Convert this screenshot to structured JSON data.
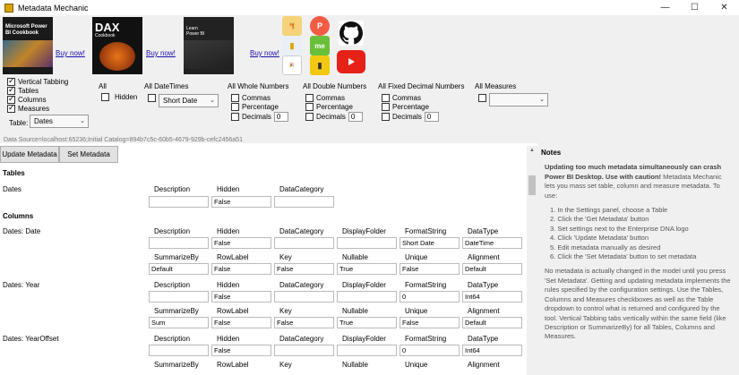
{
  "window": {
    "title": "Metadata Mechanic",
    "controls": [
      "—",
      "☐",
      "✕"
    ]
  },
  "books": [
    {
      "title_line1": "Microsoft Power",
      "title_line2": "BI Cookbook",
      "buy_label": "Buy now!",
      "color": "#1a1a1a"
    },
    {
      "title_line1": "DAX",
      "title_line2": "Cookbook",
      "buy_label": "Buy now!",
      "color": "#b83a0c"
    },
    {
      "title_line1": "Learn",
      "title_line2": "Power BI",
      "buy_label": "Buy now!",
      "color": "#222222"
    }
  ],
  "social_icons": [
    "pancake-icon",
    "patreon-icon",
    "pbi-icon",
    "me-icon",
    "celebrating-icon",
    "power-bi-icon",
    "github-icon",
    "youtube-icon"
  ],
  "settings": {
    "vertical_tabbing": "Vertical Tabbing",
    "tables": "Tables",
    "columns": "Columns",
    "measures": "Measures",
    "table_label": "Table:",
    "table_value": "Dates",
    "all_label": "All",
    "hidden_label": "Hidden",
    "all_datetimes": "All DateTimes",
    "datetime_format": "Short Date",
    "all_whole_numbers": "All Whole Numbers",
    "all_double_numbers": "All Double Numbers",
    "all_fixed_decimal": "All Fixed Decimal Numbers",
    "all_measures": "All Measures",
    "commas": "Commas",
    "percentage": "Percentage",
    "decimals": "Decimals",
    "decimals_value": "0",
    "data_source": "Data Source=localhost:65236;Initial Catalog=894b7c5c-60b5-4679-929b-cefc2456a51"
  },
  "buttons": {
    "update": "Update Metadata",
    "set": "Set Metadata"
  },
  "main": {
    "tables_heading": "Tables",
    "columns_heading": "Columns",
    "table_dates": {
      "name": "Dates",
      "headers": [
        "Description",
        "Hidden",
        "DataCategory"
      ],
      "values": [
        "",
        "False",
        ""
      ]
    },
    "columns": [
      {
        "name": "Dates: Date",
        "headers1": [
          "Description",
          "Hidden",
          "DataCategory",
          "DisplayFolder",
          "FormatString",
          "DataType"
        ],
        "values1": [
          "",
          "False",
          "",
          "",
          "Short Date",
          "DateTime"
        ],
        "headers2": [
          "SummarizeBy",
          "RowLabel",
          "Key",
          "Nullable",
          "Unique",
          "Alignment"
        ],
        "values2": [
          "Default",
          "False",
          "False",
          "True",
          "False",
          "Default"
        ]
      },
      {
        "name": "Dates: Year",
        "headers1": [
          "Description",
          "Hidden",
          "DataCategory",
          "DisplayFolder",
          "FormatString",
          "DataType"
        ],
        "values1": [
          "",
          "False",
          "",
          "",
          "0",
          "Int64"
        ],
        "headers2": [
          "SummarizeBy",
          "RowLabel",
          "Key",
          "Nullable",
          "Unique",
          "Alignment"
        ],
        "values2": [
          "Sum",
          "False",
          "False",
          "True",
          "False",
          "Default"
        ]
      },
      {
        "name": "Dates: YearOffset",
        "headers1": [
          "Description",
          "Hidden",
          "DataCategory",
          "DisplayFolder",
          "FormatString",
          "DataType"
        ],
        "values1": [
          "",
          "False",
          "",
          "",
          "0",
          "Int64"
        ],
        "headers2": [
          "SummarizeBy",
          "RowLabel",
          "Key",
          "Nullable",
          "Unique",
          "Alignment"
        ],
        "values2": []
      }
    ]
  },
  "notes": {
    "heading": "Notes",
    "warning": "Updating too much metadata simultaneously can crash Power BI Desktop. Use with caution!",
    "intro": "Metadata Mechanic lets you mass set table, column and measure metadata. To use:",
    "steps": [
      "1. In the Settings panel, choose a Table",
      "2. Click the 'Get Metadata' button",
      "3. Set settings next to the Enterprise DNA logo",
      "4. Click 'Update Metadata' button",
      "5. Edit metadata manually as desired",
      "6. Click the 'Set Metadata' button to set metadata"
    ],
    "body": "No metadata is actually changed in the model until you press 'Set Metadata'. Getting and updating metadata implements the rules specified by the configuration settings. Use the Tables, Columns and Measures checkboxes as well as the Table dropdown to control what is returned and configured by the tool. Vertical Tabbing tabs vertically within the same field (like Description or SummarizeBy) for all Tables, Columns and Measures."
  }
}
